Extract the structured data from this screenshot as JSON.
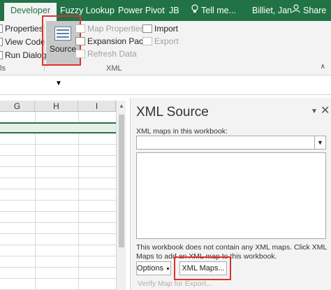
{
  "ribbon": {
    "tabs": [
      "Developer",
      "Fuzzy Lookup",
      "Power Pivot",
      "JB"
    ],
    "tell_me": "Tell me...",
    "user": "Billiet, Jan",
    "share": "Share",
    "code_group": {
      "properties": "Properties",
      "view_code": "View Code",
      "run_dialog": "Run Dialog",
      "label_tail": "ls"
    },
    "xml_group": {
      "source": "Source",
      "map_properties": "Map Properties",
      "expansion_packs": "Expansion Packs",
      "refresh_data": "Refresh Data",
      "import": "Import",
      "export": "Export",
      "label": "XML"
    }
  },
  "grid": {
    "columns": [
      "G",
      "H",
      "I"
    ]
  },
  "pane": {
    "title": "XML Source",
    "subtitle": "XML maps in this workbook:",
    "message": "This workbook does not contain any XML maps. Click XML Maps to add an XML map to this workbook.",
    "options_button": "Options",
    "xml_maps_button": "XML Maps...",
    "verify": "Verify Map for Export..."
  },
  "colors": {
    "ribbon_green": "#217346",
    "highlight_red": "#e03030"
  }
}
